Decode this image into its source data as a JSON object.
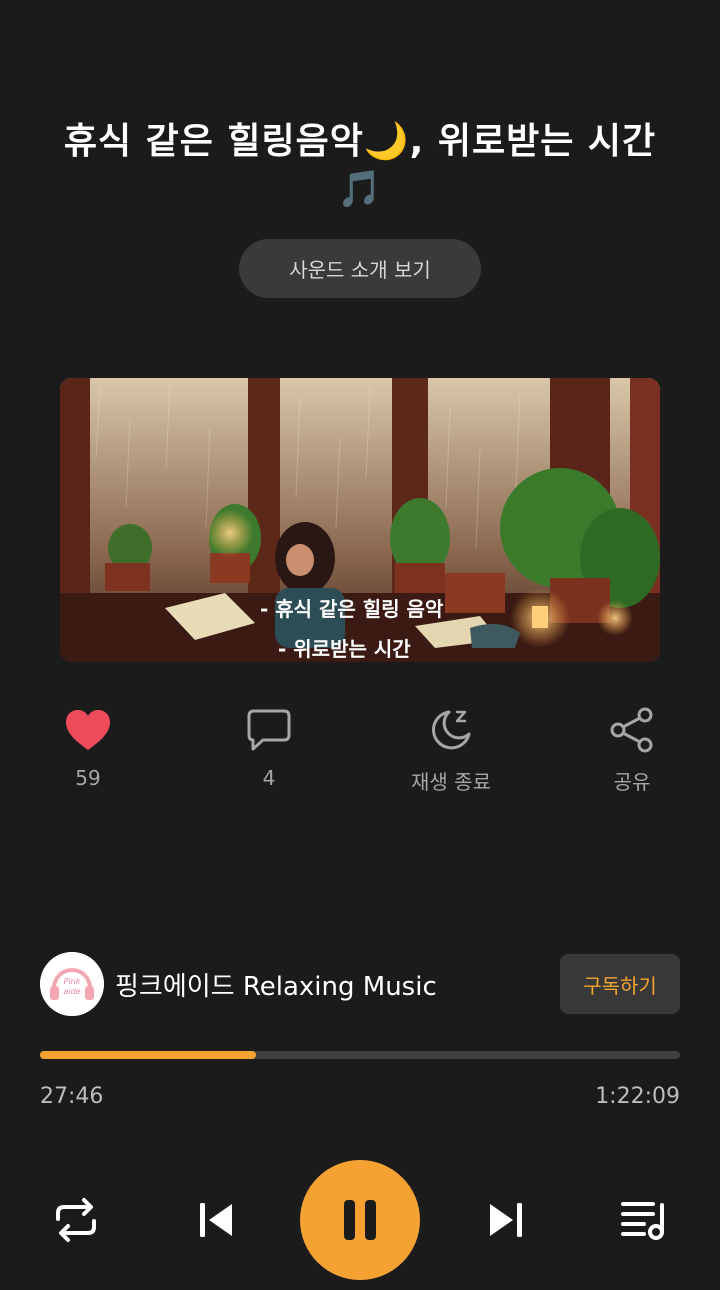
{
  "title": "휴식 같은 힐링음악🌙, 위로받는 시간🎵",
  "intro_button": "사운드 소개 보기",
  "cover": {
    "caption_line1": "- 휴식 같은 힐링 음악",
    "caption_line2": "- 위로받는 시간"
  },
  "actions": {
    "like": {
      "icon": "heart-icon",
      "label": "59",
      "color": "#ef4b5a"
    },
    "comment": {
      "icon": "chat-bubble-icon",
      "label": "4"
    },
    "sleep_timer": {
      "icon": "moon-zz-icon",
      "label": "재생 종료"
    },
    "share": {
      "icon": "share-icon",
      "label": "공유"
    }
  },
  "channel": {
    "name": "핑크에이드 Relaxing Music",
    "avatar_text": "Pink aide",
    "subscribe_label": "구독하기"
  },
  "player": {
    "elapsed": "27:46",
    "duration": "1:22:09",
    "progress": 0.338,
    "accent": "#f4a232",
    "icons": [
      "repeat-icon",
      "previous-icon",
      "pause-icon",
      "next-icon",
      "playlist-icon"
    ]
  }
}
